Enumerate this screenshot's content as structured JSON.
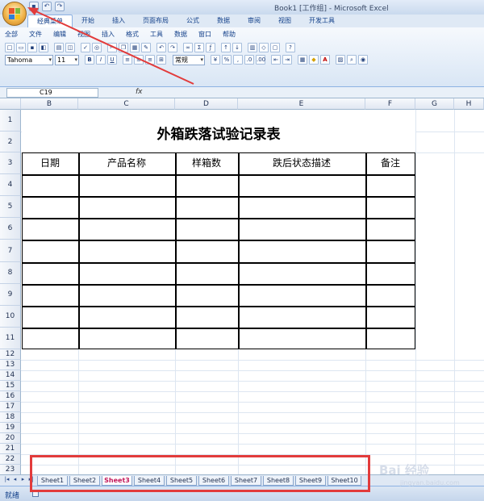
{
  "window": {
    "title": "Book1 [工作组] - Microsoft Excel"
  },
  "ribbon_tabs": [
    "经典菜单",
    "开始",
    "插入",
    "页面布局",
    "公式",
    "数据",
    "审阅",
    "视图",
    "开发工具"
  ],
  "classic_menu": [
    "全部",
    "文件",
    "编辑",
    "视图",
    "插入",
    "格式",
    "工具",
    "数据",
    "窗口",
    "帮助"
  ],
  "font": {
    "name": "Tahoma",
    "size": "11",
    "number_format": "常规"
  },
  "formula_bar": {
    "cell_ref": "C19",
    "fx_label": "fx"
  },
  "columns": [
    "B",
    "C",
    "D",
    "E",
    "F",
    "G",
    "H"
  ],
  "rows": [
    "1",
    "2",
    "3",
    "4",
    "5",
    "6",
    "7",
    "8",
    "9",
    "10",
    "11",
    "12",
    "13",
    "14",
    "15",
    "16",
    "17",
    "18",
    "19",
    "20",
    "21",
    "22",
    "23"
  ],
  "sheet": {
    "title": "外箱跌落试验记录表",
    "headers": [
      "日期",
      "产品名称",
      "样箱数",
      "跌后状态描述",
      "备注"
    ]
  },
  "sheet_tabs": [
    "Sheet1",
    "Sheet2",
    "Sheet3",
    "Sheet4",
    "Sheet5",
    "Sheet6",
    "Sheet7",
    "Sheet8",
    "Sheet9",
    "Sheet10"
  ],
  "active_sheet": "Sheet3",
  "status": {
    "text": "就绪"
  },
  "watermark": {
    "main": "Bai 经验",
    "sub": "jingyan.baidu.com"
  },
  "colors": {
    "annotation_red": "#e23b3b",
    "active_tab_text": "#c2185b"
  }
}
